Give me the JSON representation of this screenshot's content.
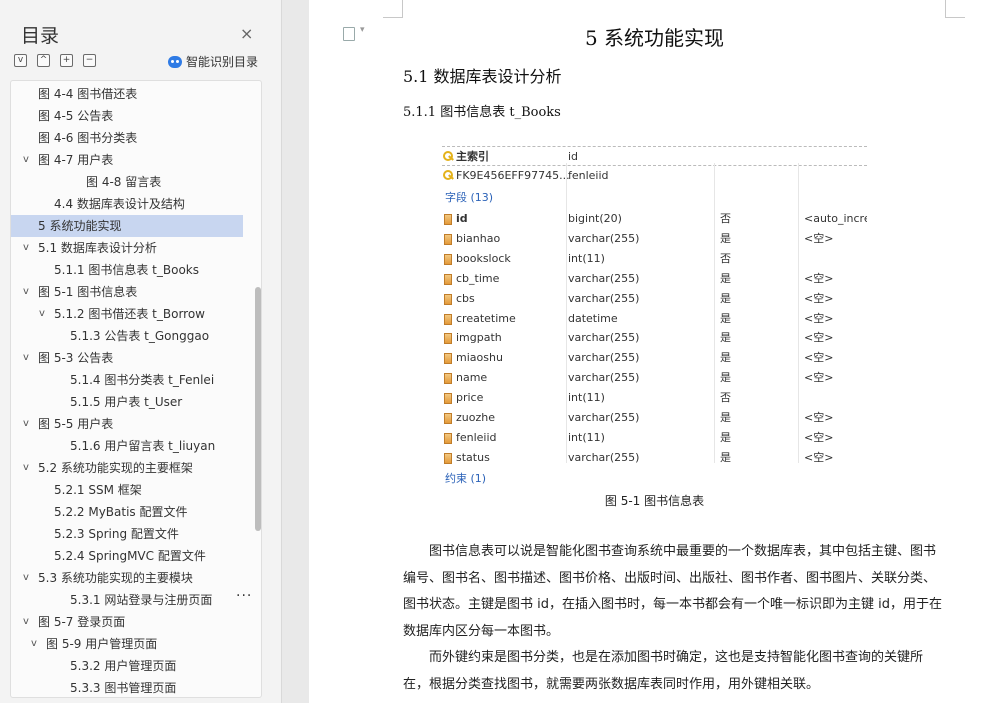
{
  "toc": {
    "title": "目录",
    "close_icon": "×",
    "tools": [
      "v",
      "^",
      "+",
      "−"
    ],
    "smart_label": "智能识别目录",
    "more": "...",
    "items": [
      {
        "label": "图 4-4  图书借还表",
        "indent": 0,
        "caret": "",
        "active": false
      },
      {
        "label": "图 4-5  公告表",
        "indent": 0,
        "caret": "",
        "active": false
      },
      {
        "label": "图 4-6  图书分类表",
        "indent": 0,
        "caret": "",
        "active": false
      },
      {
        "label": "图 4-7  用户表",
        "indent": 0,
        "caret": "v",
        "active": false
      },
      {
        "label": "图 4-8  留言表",
        "indent": 3,
        "caret": "",
        "active": false
      },
      {
        "label": "4.4 数据库表设计及结构",
        "indent": 1,
        "caret": "",
        "active": false
      },
      {
        "label": "5 系统功能实现",
        "indent": 0,
        "caret": "",
        "active": true
      },
      {
        "label": "5.1 数据库表设计分析",
        "indent": 0,
        "caret": "v",
        "active": false
      },
      {
        "label": "5.1.1 图书信息表 t_Books",
        "indent": 1,
        "caret": "",
        "active": false
      },
      {
        "label": "图 5-1  图书信息表",
        "indent": 0,
        "caret": "v",
        "active": false
      },
      {
        "label": "5.1.2 图书借还表 t_Borrow",
        "indent": 1,
        "caret": "v",
        "active": false
      },
      {
        "label": "5.1.3 公告表 t_Gonggao",
        "indent": 2,
        "caret": "",
        "active": false
      },
      {
        "label": "图  5-3  公告表",
        "indent": 0,
        "caret": "v",
        "active": false
      },
      {
        "label": "5.1.4 图书分类表 t_Fenlei",
        "indent": 2,
        "caret": "",
        "active": false
      },
      {
        "label": "5.1.5 用户表 t_User",
        "indent": 2,
        "caret": "",
        "active": false
      },
      {
        "label": "图  5-5  用户表",
        "indent": 0,
        "caret": "v",
        "active": false
      },
      {
        "label": "5.1.6 用户留言表 t_liuyan",
        "indent": 2,
        "caret": "",
        "active": false
      },
      {
        "label": "5.2 系统功能实现的主要框架",
        "indent": 0,
        "caret": "v",
        "active": false
      },
      {
        "label": "5.2.1 SSM 框架",
        "indent": 1,
        "caret": "",
        "active": false
      },
      {
        "label": "5.2.2 MyBatis 配置文件",
        "indent": 1,
        "caret": "",
        "active": false
      },
      {
        "label": "5.2.3 Spring 配置文件",
        "indent": 1,
        "caret": "",
        "active": false
      },
      {
        "label": "5.2.4 SpringMVC  配置文件",
        "indent": 1,
        "caret": "",
        "active": false
      },
      {
        "label": "5.3 系统功能实现的主要模块",
        "indent": 0,
        "caret": "v",
        "active": false
      },
      {
        "label": "5.3.1  网站登录与注册页面",
        "indent": 2,
        "caret": "",
        "active": false
      },
      {
        "label": "图  5-7  登录页面",
        "indent": 0,
        "caret": "v",
        "active": false
      },
      {
        "label": "图 5-9  用户管理页面",
        "indent": 0.5,
        "caret": "v",
        "active": false
      },
      {
        "label": "5.3.2  用户管理页面",
        "indent": 2,
        "caret": "",
        "active": false
      },
      {
        "label": "5.3.3  图书管理页面",
        "indent": 2,
        "caret": "",
        "active": false
      }
    ]
  },
  "doc": {
    "h1": "5 系统功能实现",
    "h2": "5.1 数据库表设计分析",
    "h3": "5.1.1 图书信息表 t_Books",
    "figure": {
      "keys_header": [
        "主索引",
        "id"
      ],
      "fk_row": [
        "FK9E456EFF97745...",
        "fenleiid"
      ],
      "fields_label": "字段 (13)",
      "fields": [
        [
          "id",
          "bigint(20)",
          "否",
          "<auto_increment>"
        ],
        [
          "bianhao",
          "varchar(255)",
          "是",
          "<空>"
        ],
        [
          "bookslock",
          "int(11)",
          "否",
          ""
        ],
        [
          "cb_time",
          "varchar(255)",
          "是",
          "<空>"
        ],
        [
          "cbs",
          "varchar(255)",
          "是",
          "<空>"
        ],
        [
          "createtime",
          "datetime",
          "是",
          "<空>"
        ],
        [
          "imgpath",
          "varchar(255)",
          "是",
          "<空>"
        ],
        [
          "miaoshu",
          "varchar(255)",
          "是",
          "<空>"
        ],
        [
          "name",
          "varchar(255)",
          "是",
          "<空>"
        ],
        [
          "price",
          "int(11)",
          "否",
          ""
        ],
        [
          "zuozhe",
          "varchar(255)",
          "是",
          "<空>"
        ],
        [
          "fenleiid",
          "int(11)",
          "是",
          "<空>"
        ],
        [
          "status",
          "varchar(255)",
          "是",
          "<空>"
        ]
      ],
      "constraints_label": "约束 (1)"
    },
    "caption": "图 5-1  图书信息表",
    "para1": [
      "图书信息表可以说是智能化图书查询系统中最重要的一个数据库表，其中包括主",
      "键、图书编号、图书名、图书描述、图书价格、出版时间、出版社、图书作者、图书图",
      "片、关联分类、图书状态。主键是图书 id，在插入图书时，每一本书都会有一个唯一",
      "标识即为主键 id，用于在数据库内区分每一本图书。"
    ],
    "para2": [
      "而外键约束是图书分类，也是在添加图书时确定，这也是支持智能化图书查询的关",
      "键所在，根据分类查找图书，就需要两张数据库表同时作用，用外键相关联。"
    ]
  }
}
